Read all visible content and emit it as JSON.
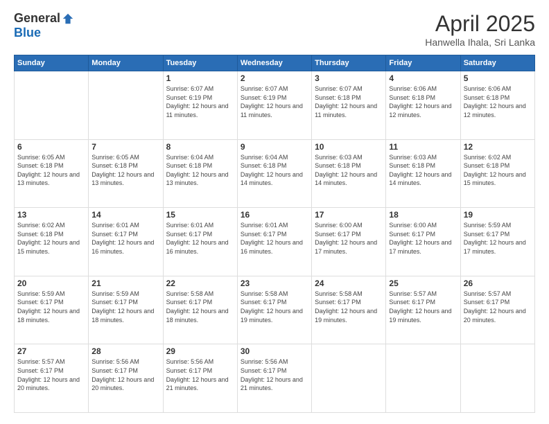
{
  "logo": {
    "general": "General",
    "blue": "Blue"
  },
  "header": {
    "month_title": "April 2025",
    "subtitle": "Hanwella Ihala, Sri Lanka"
  },
  "days_of_week": [
    "Sunday",
    "Monday",
    "Tuesday",
    "Wednesday",
    "Thursday",
    "Friday",
    "Saturday"
  ],
  "weeks": [
    [
      {
        "day": "",
        "info": ""
      },
      {
        "day": "",
        "info": ""
      },
      {
        "day": "1",
        "info": "Sunrise: 6:07 AM\nSunset: 6:19 PM\nDaylight: 12 hours and 11 minutes."
      },
      {
        "day": "2",
        "info": "Sunrise: 6:07 AM\nSunset: 6:19 PM\nDaylight: 12 hours and 11 minutes."
      },
      {
        "day": "3",
        "info": "Sunrise: 6:07 AM\nSunset: 6:18 PM\nDaylight: 12 hours and 11 minutes."
      },
      {
        "day": "4",
        "info": "Sunrise: 6:06 AM\nSunset: 6:18 PM\nDaylight: 12 hours and 12 minutes."
      },
      {
        "day": "5",
        "info": "Sunrise: 6:06 AM\nSunset: 6:18 PM\nDaylight: 12 hours and 12 minutes."
      }
    ],
    [
      {
        "day": "6",
        "info": "Sunrise: 6:05 AM\nSunset: 6:18 PM\nDaylight: 12 hours and 13 minutes."
      },
      {
        "day": "7",
        "info": "Sunrise: 6:05 AM\nSunset: 6:18 PM\nDaylight: 12 hours and 13 minutes."
      },
      {
        "day": "8",
        "info": "Sunrise: 6:04 AM\nSunset: 6:18 PM\nDaylight: 12 hours and 13 minutes."
      },
      {
        "day": "9",
        "info": "Sunrise: 6:04 AM\nSunset: 6:18 PM\nDaylight: 12 hours and 14 minutes."
      },
      {
        "day": "10",
        "info": "Sunrise: 6:03 AM\nSunset: 6:18 PM\nDaylight: 12 hours and 14 minutes."
      },
      {
        "day": "11",
        "info": "Sunrise: 6:03 AM\nSunset: 6:18 PM\nDaylight: 12 hours and 14 minutes."
      },
      {
        "day": "12",
        "info": "Sunrise: 6:02 AM\nSunset: 6:18 PM\nDaylight: 12 hours and 15 minutes."
      }
    ],
    [
      {
        "day": "13",
        "info": "Sunrise: 6:02 AM\nSunset: 6:18 PM\nDaylight: 12 hours and 15 minutes."
      },
      {
        "day": "14",
        "info": "Sunrise: 6:01 AM\nSunset: 6:17 PM\nDaylight: 12 hours and 16 minutes."
      },
      {
        "day": "15",
        "info": "Sunrise: 6:01 AM\nSunset: 6:17 PM\nDaylight: 12 hours and 16 minutes."
      },
      {
        "day": "16",
        "info": "Sunrise: 6:01 AM\nSunset: 6:17 PM\nDaylight: 12 hours and 16 minutes."
      },
      {
        "day": "17",
        "info": "Sunrise: 6:00 AM\nSunset: 6:17 PM\nDaylight: 12 hours and 17 minutes."
      },
      {
        "day": "18",
        "info": "Sunrise: 6:00 AM\nSunset: 6:17 PM\nDaylight: 12 hours and 17 minutes."
      },
      {
        "day": "19",
        "info": "Sunrise: 5:59 AM\nSunset: 6:17 PM\nDaylight: 12 hours and 17 minutes."
      }
    ],
    [
      {
        "day": "20",
        "info": "Sunrise: 5:59 AM\nSunset: 6:17 PM\nDaylight: 12 hours and 18 minutes."
      },
      {
        "day": "21",
        "info": "Sunrise: 5:59 AM\nSunset: 6:17 PM\nDaylight: 12 hours and 18 minutes."
      },
      {
        "day": "22",
        "info": "Sunrise: 5:58 AM\nSunset: 6:17 PM\nDaylight: 12 hours and 18 minutes."
      },
      {
        "day": "23",
        "info": "Sunrise: 5:58 AM\nSunset: 6:17 PM\nDaylight: 12 hours and 19 minutes."
      },
      {
        "day": "24",
        "info": "Sunrise: 5:58 AM\nSunset: 6:17 PM\nDaylight: 12 hours and 19 minutes."
      },
      {
        "day": "25",
        "info": "Sunrise: 5:57 AM\nSunset: 6:17 PM\nDaylight: 12 hours and 19 minutes."
      },
      {
        "day": "26",
        "info": "Sunrise: 5:57 AM\nSunset: 6:17 PM\nDaylight: 12 hours and 20 minutes."
      }
    ],
    [
      {
        "day": "27",
        "info": "Sunrise: 5:57 AM\nSunset: 6:17 PM\nDaylight: 12 hours and 20 minutes."
      },
      {
        "day": "28",
        "info": "Sunrise: 5:56 AM\nSunset: 6:17 PM\nDaylight: 12 hours and 20 minutes."
      },
      {
        "day": "29",
        "info": "Sunrise: 5:56 AM\nSunset: 6:17 PM\nDaylight: 12 hours and 21 minutes."
      },
      {
        "day": "30",
        "info": "Sunrise: 5:56 AM\nSunset: 6:17 PM\nDaylight: 12 hours and 21 minutes."
      },
      {
        "day": "",
        "info": ""
      },
      {
        "day": "",
        "info": ""
      },
      {
        "day": "",
        "info": ""
      }
    ]
  ]
}
